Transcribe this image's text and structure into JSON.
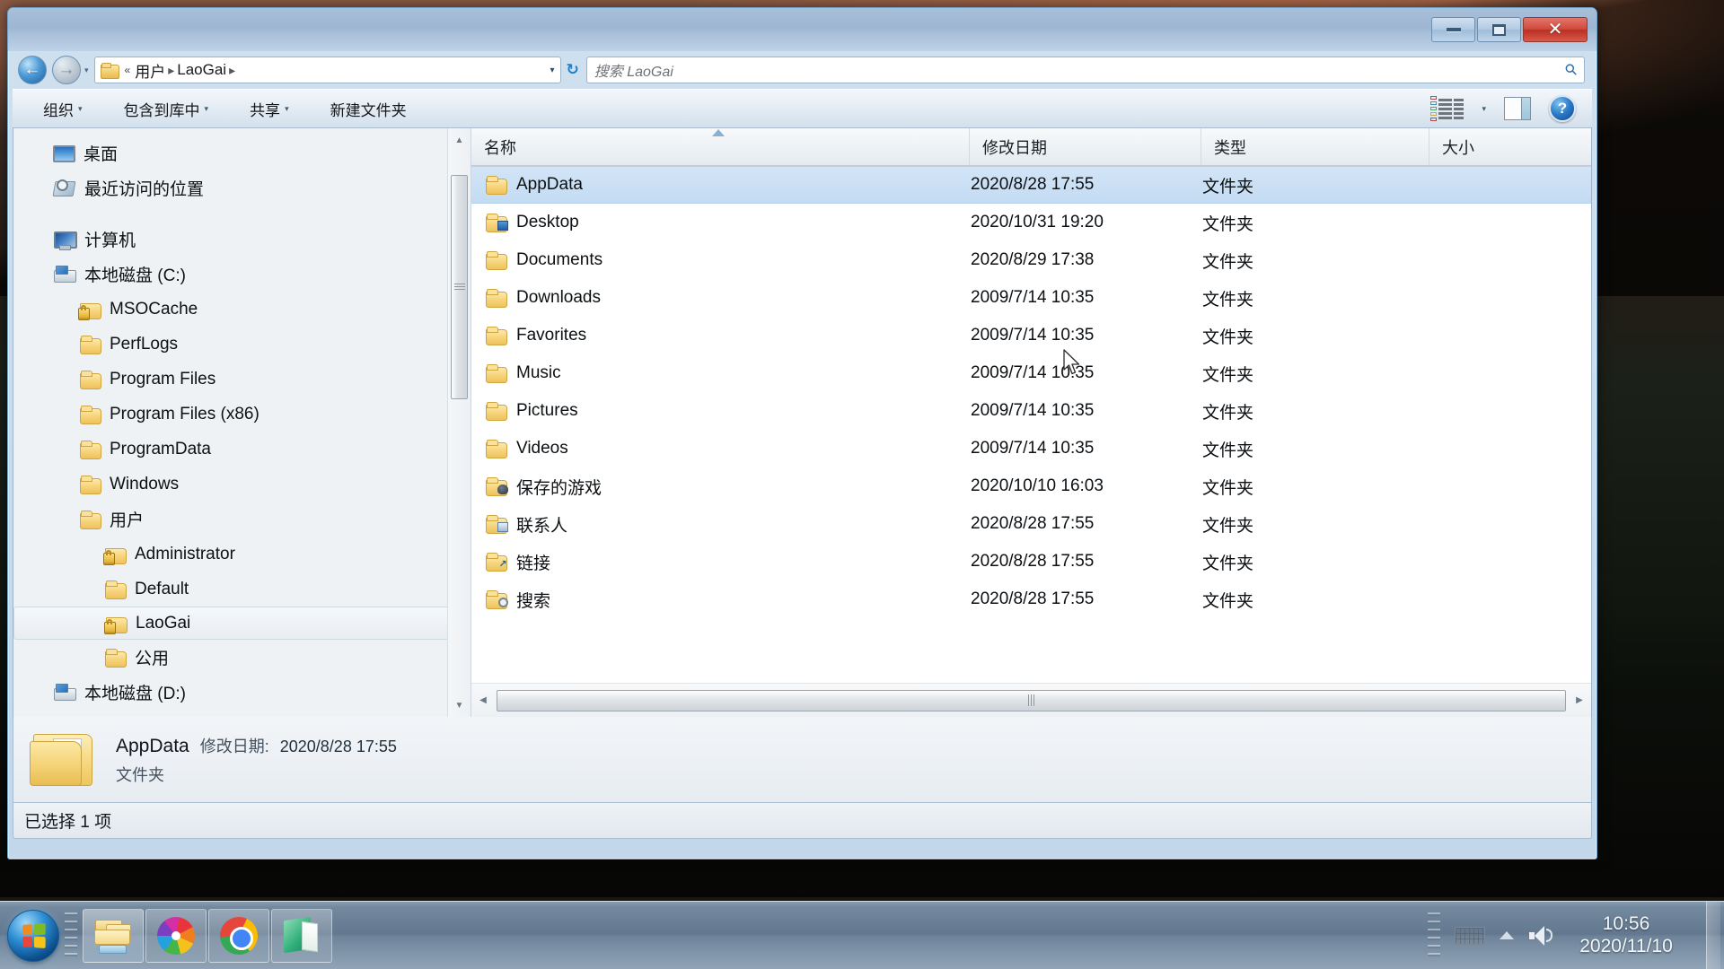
{
  "window": {
    "controls": {
      "minimize": "—",
      "maximize": "▢",
      "close": "✕"
    }
  },
  "addressbar": {
    "back_glyph": "←",
    "forward_glyph": "→",
    "dropdown_glyph": "▾",
    "root_sep": "«",
    "crumbs": [
      "用户",
      "LaoGai"
    ],
    "chevron": "▸",
    "caret": "▾",
    "refresh_glyph": "↻",
    "search_placeholder": "搜索 LaoGai",
    "search_icon": "search-icon"
  },
  "toolbar": {
    "items": [
      {
        "label": "组织",
        "caret": "▾"
      },
      {
        "label": "包含到库中",
        "caret": "▾"
      },
      {
        "label": "共享",
        "caret": "▾"
      },
      {
        "label": "新建文件夹",
        "caret": ""
      }
    ],
    "view_caret": "▾",
    "help_label": "?"
  },
  "navpane": {
    "items": [
      {
        "label": "桌面",
        "icon": "desktop-icon",
        "level": 1,
        "locked": false,
        "selected": false
      },
      {
        "label": "最近访问的位置",
        "icon": "recent-places-icon",
        "level": 1,
        "locked": false,
        "selected": false
      },
      {
        "label": "计算机",
        "icon": "computer-icon",
        "level": 1,
        "locked": false,
        "selected": false,
        "gap_before": true
      },
      {
        "label": "本地磁盘 (C:)",
        "icon": "drive-icon",
        "level": 1,
        "locked": false,
        "selected": false
      },
      {
        "label": "MSOCache",
        "icon": "folder-icon",
        "level": 2,
        "locked": true,
        "selected": false
      },
      {
        "label": "PerfLogs",
        "icon": "folder-icon",
        "level": 2,
        "locked": false,
        "selected": false
      },
      {
        "label": "Program Files",
        "icon": "folder-icon",
        "level": 2,
        "locked": false,
        "selected": false
      },
      {
        "label": "Program Files (x86)",
        "icon": "folder-icon",
        "level": 2,
        "locked": false,
        "selected": false
      },
      {
        "label": "ProgramData",
        "icon": "folder-icon",
        "level": 2,
        "locked": false,
        "selected": false
      },
      {
        "label": "Windows",
        "icon": "folder-icon",
        "level": 2,
        "locked": false,
        "selected": false
      },
      {
        "label": "用户",
        "icon": "folder-icon",
        "level": 2,
        "locked": false,
        "selected": false
      },
      {
        "label": "Administrator",
        "icon": "folder-icon",
        "level": 3,
        "locked": true,
        "selected": false
      },
      {
        "label": "Default",
        "icon": "folder-icon",
        "level": 3,
        "locked": false,
        "selected": false
      },
      {
        "label": "LaoGai",
        "icon": "folder-icon",
        "level": 3,
        "locked": true,
        "selected": true
      },
      {
        "label": "公用",
        "icon": "folder-icon",
        "level": 3,
        "locked": false,
        "selected": false
      },
      {
        "label": "本地磁盘 (D:)",
        "icon": "drive-icon",
        "level": 1,
        "locked": false,
        "selected": false
      }
    ],
    "scroll_up": "▲",
    "scroll_down": "▼"
  },
  "filelist": {
    "columns": [
      {
        "key": "name",
        "label": "名称"
      },
      {
        "key": "date",
        "label": "修改日期"
      },
      {
        "key": "type",
        "label": "类型"
      },
      {
        "key": "size",
        "label": "大小"
      }
    ],
    "sort_column": "名称",
    "sort_direction": "asc",
    "rows": [
      {
        "name": "AppData",
        "date": "2020/8/28 17:55",
        "type": "文件夹",
        "size": "",
        "icon": "folder-icon",
        "selected": true
      },
      {
        "name": "Desktop",
        "date": "2020/10/31 19:20",
        "type": "文件夹",
        "size": "",
        "icon": "folder-desktop-icon",
        "selected": false
      },
      {
        "name": "Documents",
        "date": "2020/8/29 17:38",
        "type": "文件夹",
        "size": "",
        "icon": "folder-icon",
        "selected": false
      },
      {
        "name": "Downloads",
        "date": "2009/7/14 10:35",
        "type": "文件夹",
        "size": "",
        "icon": "folder-icon",
        "selected": false
      },
      {
        "name": "Favorites",
        "date": "2009/7/14 10:35",
        "type": "文件夹",
        "size": "",
        "icon": "folder-icon",
        "selected": false
      },
      {
        "name": "Music",
        "date": "2009/7/14 10:35",
        "type": "文件夹",
        "size": "",
        "icon": "folder-icon",
        "selected": false
      },
      {
        "name": "Pictures",
        "date": "2009/7/14 10:35",
        "type": "文件夹",
        "size": "",
        "icon": "folder-icon",
        "selected": false
      },
      {
        "name": "Videos",
        "date": "2009/7/14 10:35",
        "type": "文件夹",
        "size": "",
        "icon": "folder-icon",
        "selected": false
      },
      {
        "name": "保存的游戏",
        "date": "2020/10/10 16:03",
        "type": "文件夹",
        "size": "",
        "icon": "folder-games-icon",
        "selected": false
      },
      {
        "name": "联系人",
        "date": "2020/8/28 17:55",
        "type": "文件夹",
        "size": "",
        "icon": "folder-contacts-icon",
        "selected": false
      },
      {
        "name": "链接",
        "date": "2020/8/28 17:55",
        "type": "文件夹",
        "size": "",
        "icon": "folder-links-icon",
        "selected": false
      },
      {
        "name": "搜索",
        "date": "2020/8/28 17:55",
        "type": "文件夹",
        "size": "",
        "icon": "folder-search-icon",
        "selected": false
      }
    ],
    "hscroll_left": "◀",
    "hscroll_right": "▶"
  },
  "details": {
    "title": "AppData",
    "modified_label": "修改日期:",
    "modified_value": "2020/8/28 17:55",
    "kind": "文件夹"
  },
  "status": {
    "text": "已选择 1 项"
  },
  "taskbar": {
    "start_name": "start-orb",
    "buttons": [
      {
        "name": "taskbar-explorer",
        "icon": "explorer-icon",
        "active": true
      },
      {
        "name": "taskbar-firefox",
        "icon": "firefox-icon",
        "active": false
      },
      {
        "name": "taskbar-chrome",
        "icon": "chrome-icon",
        "active": false
      },
      {
        "name": "taskbar-notes",
        "icon": "green-book-icon",
        "active": false
      }
    ],
    "tray": {
      "keyboard_icon": "keyboard-icon",
      "caret": "▲",
      "volume_icon": "volume-icon",
      "time": "10:56",
      "date": "2020/11/10"
    }
  },
  "colors": {
    "selection": "#c9dff4",
    "accent": "#1e7fc4",
    "folder": "#f3d27b",
    "close_button": "#cf4a3c"
  }
}
